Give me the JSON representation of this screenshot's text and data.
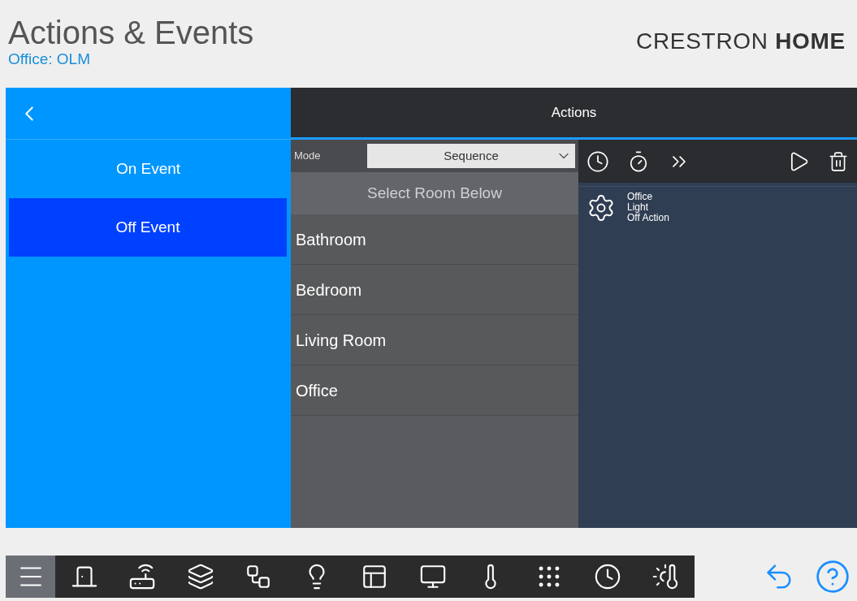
{
  "header": {
    "title": "Actions & Events",
    "subtitle": "Office: OLM",
    "brand_light": "CRESTRON",
    "brand_bold": "HOME"
  },
  "events": [
    {
      "label": "On Event",
      "selected": false
    },
    {
      "label": "Off Event",
      "selected": true
    }
  ],
  "actions_title": "Actions",
  "mode": {
    "label": "Mode",
    "value": "Sequence"
  },
  "room_header": "Select Room Below",
  "rooms": [
    "Bathroom",
    "Bedroom",
    "Living Room",
    "Office"
  ],
  "action_items": [
    {
      "lines": [
        "Office",
        "Light",
        "Off Action"
      ]
    }
  ]
}
